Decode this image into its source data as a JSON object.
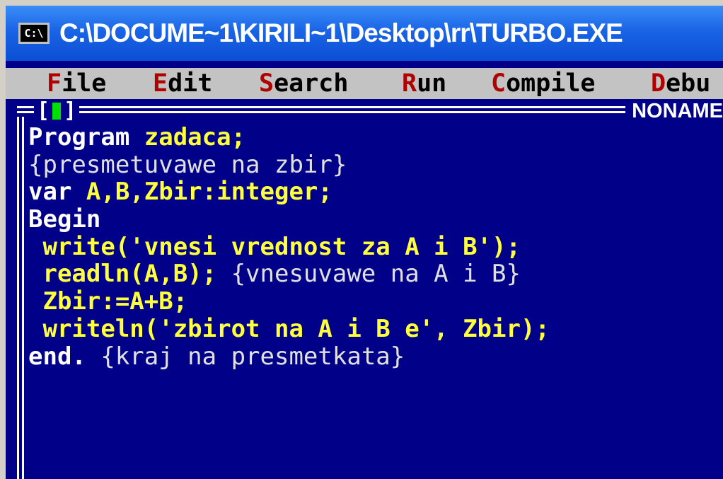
{
  "window": {
    "title": "C:\\DOCUME~1\\KIRILI~1\\Desktop\\rr\\TURBO.EXE",
    "icon": "console-icon",
    "icon_text": "C:\\"
  },
  "menu": {
    "items": [
      {
        "hotkey": "F",
        "rest": "ile"
      },
      {
        "hotkey": "E",
        "rest": "dit"
      },
      {
        "hotkey": "S",
        "rest": "earch"
      },
      {
        "hotkey": "R",
        "rest": "un"
      },
      {
        "hotkey": "C",
        "rest": "ompile"
      },
      {
        "hotkey": "D",
        "rest": "ebu"
      }
    ]
  },
  "editor": {
    "close_open": "[",
    "close_close": "]",
    "file_name": "NONAME",
    "lines": [
      [
        {
          "t": "Program ",
          "c": "w"
        },
        {
          "t": "zadaca;",
          "c": "y"
        }
      ],
      [
        {
          "t": "{presmetuvawe na zbir}",
          "c": "c"
        }
      ],
      [
        {
          "t": "var ",
          "c": "w"
        },
        {
          "t": "A,B,Zbir:integer;",
          "c": "y"
        }
      ],
      [
        {
          "t": "Begin",
          "c": "w"
        }
      ],
      [
        {
          "t": " write('vnesi vrednost za A i B');",
          "c": "y"
        }
      ],
      [
        {
          "t": " readln(A,B); ",
          "c": "y"
        },
        {
          "t": "{vnesuvawe na A i B}",
          "c": "c"
        }
      ],
      [
        {
          "t": " Zbir:=A+B;",
          "c": "y"
        }
      ],
      [
        {
          "t": " writeln('zbirot na A i B e', Zbir);",
          "c": "y"
        }
      ],
      [
        {
          "t": "end. ",
          "c": "w"
        },
        {
          "t": "{kraj na presmetkata}",
          "c": "c"
        }
      ]
    ]
  },
  "colors": {
    "background": "#000088",
    "menubar": "#c3c3c3",
    "hotkey": "#b00000",
    "keyword": "#ffffff",
    "identifier": "#ffff3c",
    "titlebar": "#1a64e6"
  }
}
